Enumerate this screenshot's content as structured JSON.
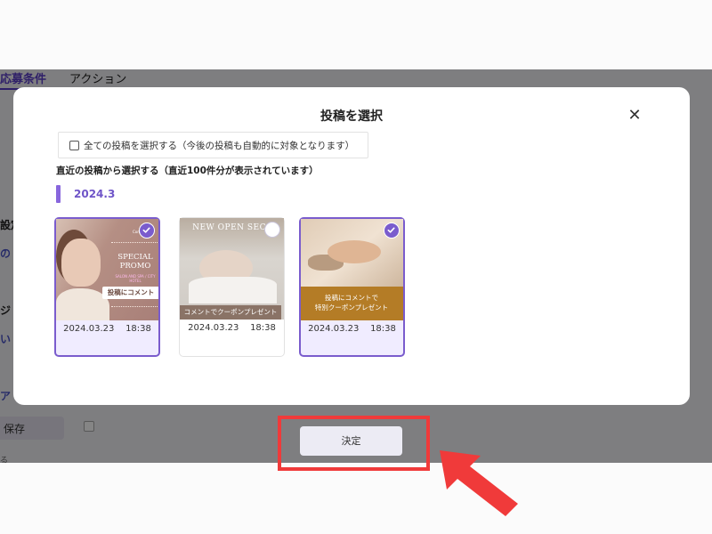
{
  "background": {
    "tabs": [
      "応募条件",
      "アクション"
    ],
    "side_labels": [
      "設定",
      "の",
      "ジ",
      "い",
      "ア"
    ],
    "save_label": "保存",
    "small_text": "る"
  },
  "modal": {
    "title": "投稿を選択",
    "select_all_label": "全ての投稿を選択する（今後の投稿も自動的に対象となります）",
    "section_heading": "直近の投稿から選択する（直近100件分が表示されています）",
    "month": "2024.3"
  },
  "posts": [
    {
      "date": "2024.03.23    18:38",
      "selected": true,
      "promo_title": "SPECIAL PROMO",
      "promo_sub": "SALON AND SPA / CITY HOTEL",
      "overlay_label": "投稿にコメント",
      "small_text": "Company"
    },
    {
      "date": "2024.03.23    18:38",
      "selected": false,
      "headline": "NEW OPEN SECO",
      "caption": "コメントでクーポンプレゼント"
    },
    {
      "date": "2024.03.23    18:38",
      "selected": true,
      "caption_line1": "投稿にコメントで",
      "caption_line2": "特別クーポンプレゼント"
    }
  ],
  "confirm_label": "決定",
  "colors": {
    "accent": "#7a5ccd",
    "highlight": "#f03a3a",
    "month_text": "#6f55c8"
  }
}
